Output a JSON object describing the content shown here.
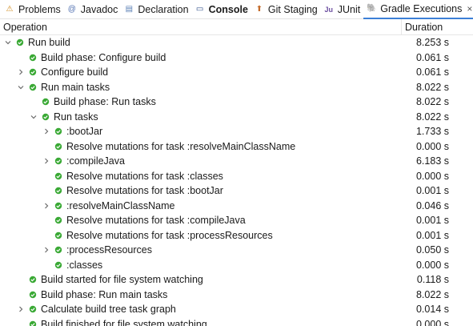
{
  "colors": {
    "success": "#3aa935",
    "accent": "#3c7fd7"
  },
  "tabs": [
    {
      "label": "Problems",
      "icon": "problems-icon",
      "glyph": "⚠",
      "bold": false,
      "active": false
    },
    {
      "label": "Javadoc",
      "icon": "javadoc-icon",
      "glyph": "@",
      "bold": false,
      "active": false
    },
    {
      "label": "Declaration",
      "icon": "declaration-icon",
      "glyph": "▤",
      "bold": false,
      "active": false
    },
    {
      "label": "Console",
      "icon": "console-icon",
      "glyph": "▭",
      "bold": true,
      "active": false
    },
    {
      "label": "Git Staging",
      "icon": "git-staging-icon",
      "glyph": "⬆",
      "bold": false,
      "active": false
    },
    {
      "label": "JUnit",
      "icon": "junit-icon",
      "glyph": "Ju",
      "bold": false,
      "active": false
    },
    {
      "label": "Gradle Executions",
      "icon": "gradle-icon",
      "glyph": "🐘",
      "bold": false,
      "active": true,
      "close": "×"
    }
  ],
  "header": {
    "operation": "Operation",
    "duration": "Duration"
  },
  "rows": [
    {
      "label": "Run build",
      "duration": "8.253 s",
      "depth": 0,
      "twisty": "expanded"
    },
    {
      "label": "Build phase: Configure build",
      "duration": "0.061 s",
      "depth": 1,
      "twisty": "none"
    },
    {
      "label": "Configure build",
      "duration": "0.061 s",
      "depth": 1,
      "twisty": "collapsed"
    },
    {
      "label": "Run main tasks",
      "duration": "8.022 s",
      "depth": 1,
      "twisty": "expanded"
    },
    {
      "label": "Build phase: Run tasks",
      "duration": "8.022 s",
      "depth": 2,
      "twisty": "none"
    },
    {
      "label": "Run tasks",
      "duration": "8.022 s",
      "depth": 2,
      "twisty": "expanded"
    },
    {
      "label": ":bootJar",
      "duration": "1.733 s",
      "depth": 3,
      "twisty": "collapsed"
    },
    {
      "label": "Resolve mutations for task :resolveMainClassName",
      "duration": "0.000 s",
      "depth": 3,
      "twisty": "none"
    },
    {
      "label": ":compileJava",
      "duration": "6.183 s",
      "depth": 3,
      "twisty": "collapsed"
    },
    {
      "label": "Resolve mutations for task :classes",
      "duration": "0.000 s",
      "depth": 3,
      "twisty": "none"
    },
    {
      "label": "Resolve mutations for task :bootJar",
      "duration": "0.001 s",
      "depth": 3,
      "twisty": "none"
    },
    {
      "label": ":resolveMainClassName",
      "duration": "0.046 s",
      "depth": 3,
      "twisty": "collapsed"
    },
    {
      "label": "Resolve mutations for task :compileJava",
      "duration": "0.001 s",
      "depth": 3,
      "twisty": "none"
    },
    {
      "label": "Resolve mutations for task :processResources",
      "duration": "0.001 s",
      "depth": 3,
      "twisty": "none"
    },
    {
      "label": ":processResources",
      "duration": "0.050 s",
      "depth": 3,
      "twisty": "collapsed"
    },
    {
      "label": ":classes",
      "duration": "0.000 s",
      "depth": 3,
      "twisty": "none"
    },
    {
      "label": "Build started for file system watching",
      "duration": "0.118 s",
      "depth": 1,
      "twisty": "none"
    },
    {
      "label": "Build phase: Run main tasks",
      "duration": "8.022 s",
      "depth": 1,
      "twisty": "none"
    },
    {
      "label": "Calculate build tree task graph",
      "duration": "0.014 s",
      "depth": 1,
      "twisty": "collapsed"
    },
    {
      "label": "Build finished for file system watching",
      "duration": "0.000 s",
      "depth": 1,
      "twisty": "none"
    }
  ]
}
